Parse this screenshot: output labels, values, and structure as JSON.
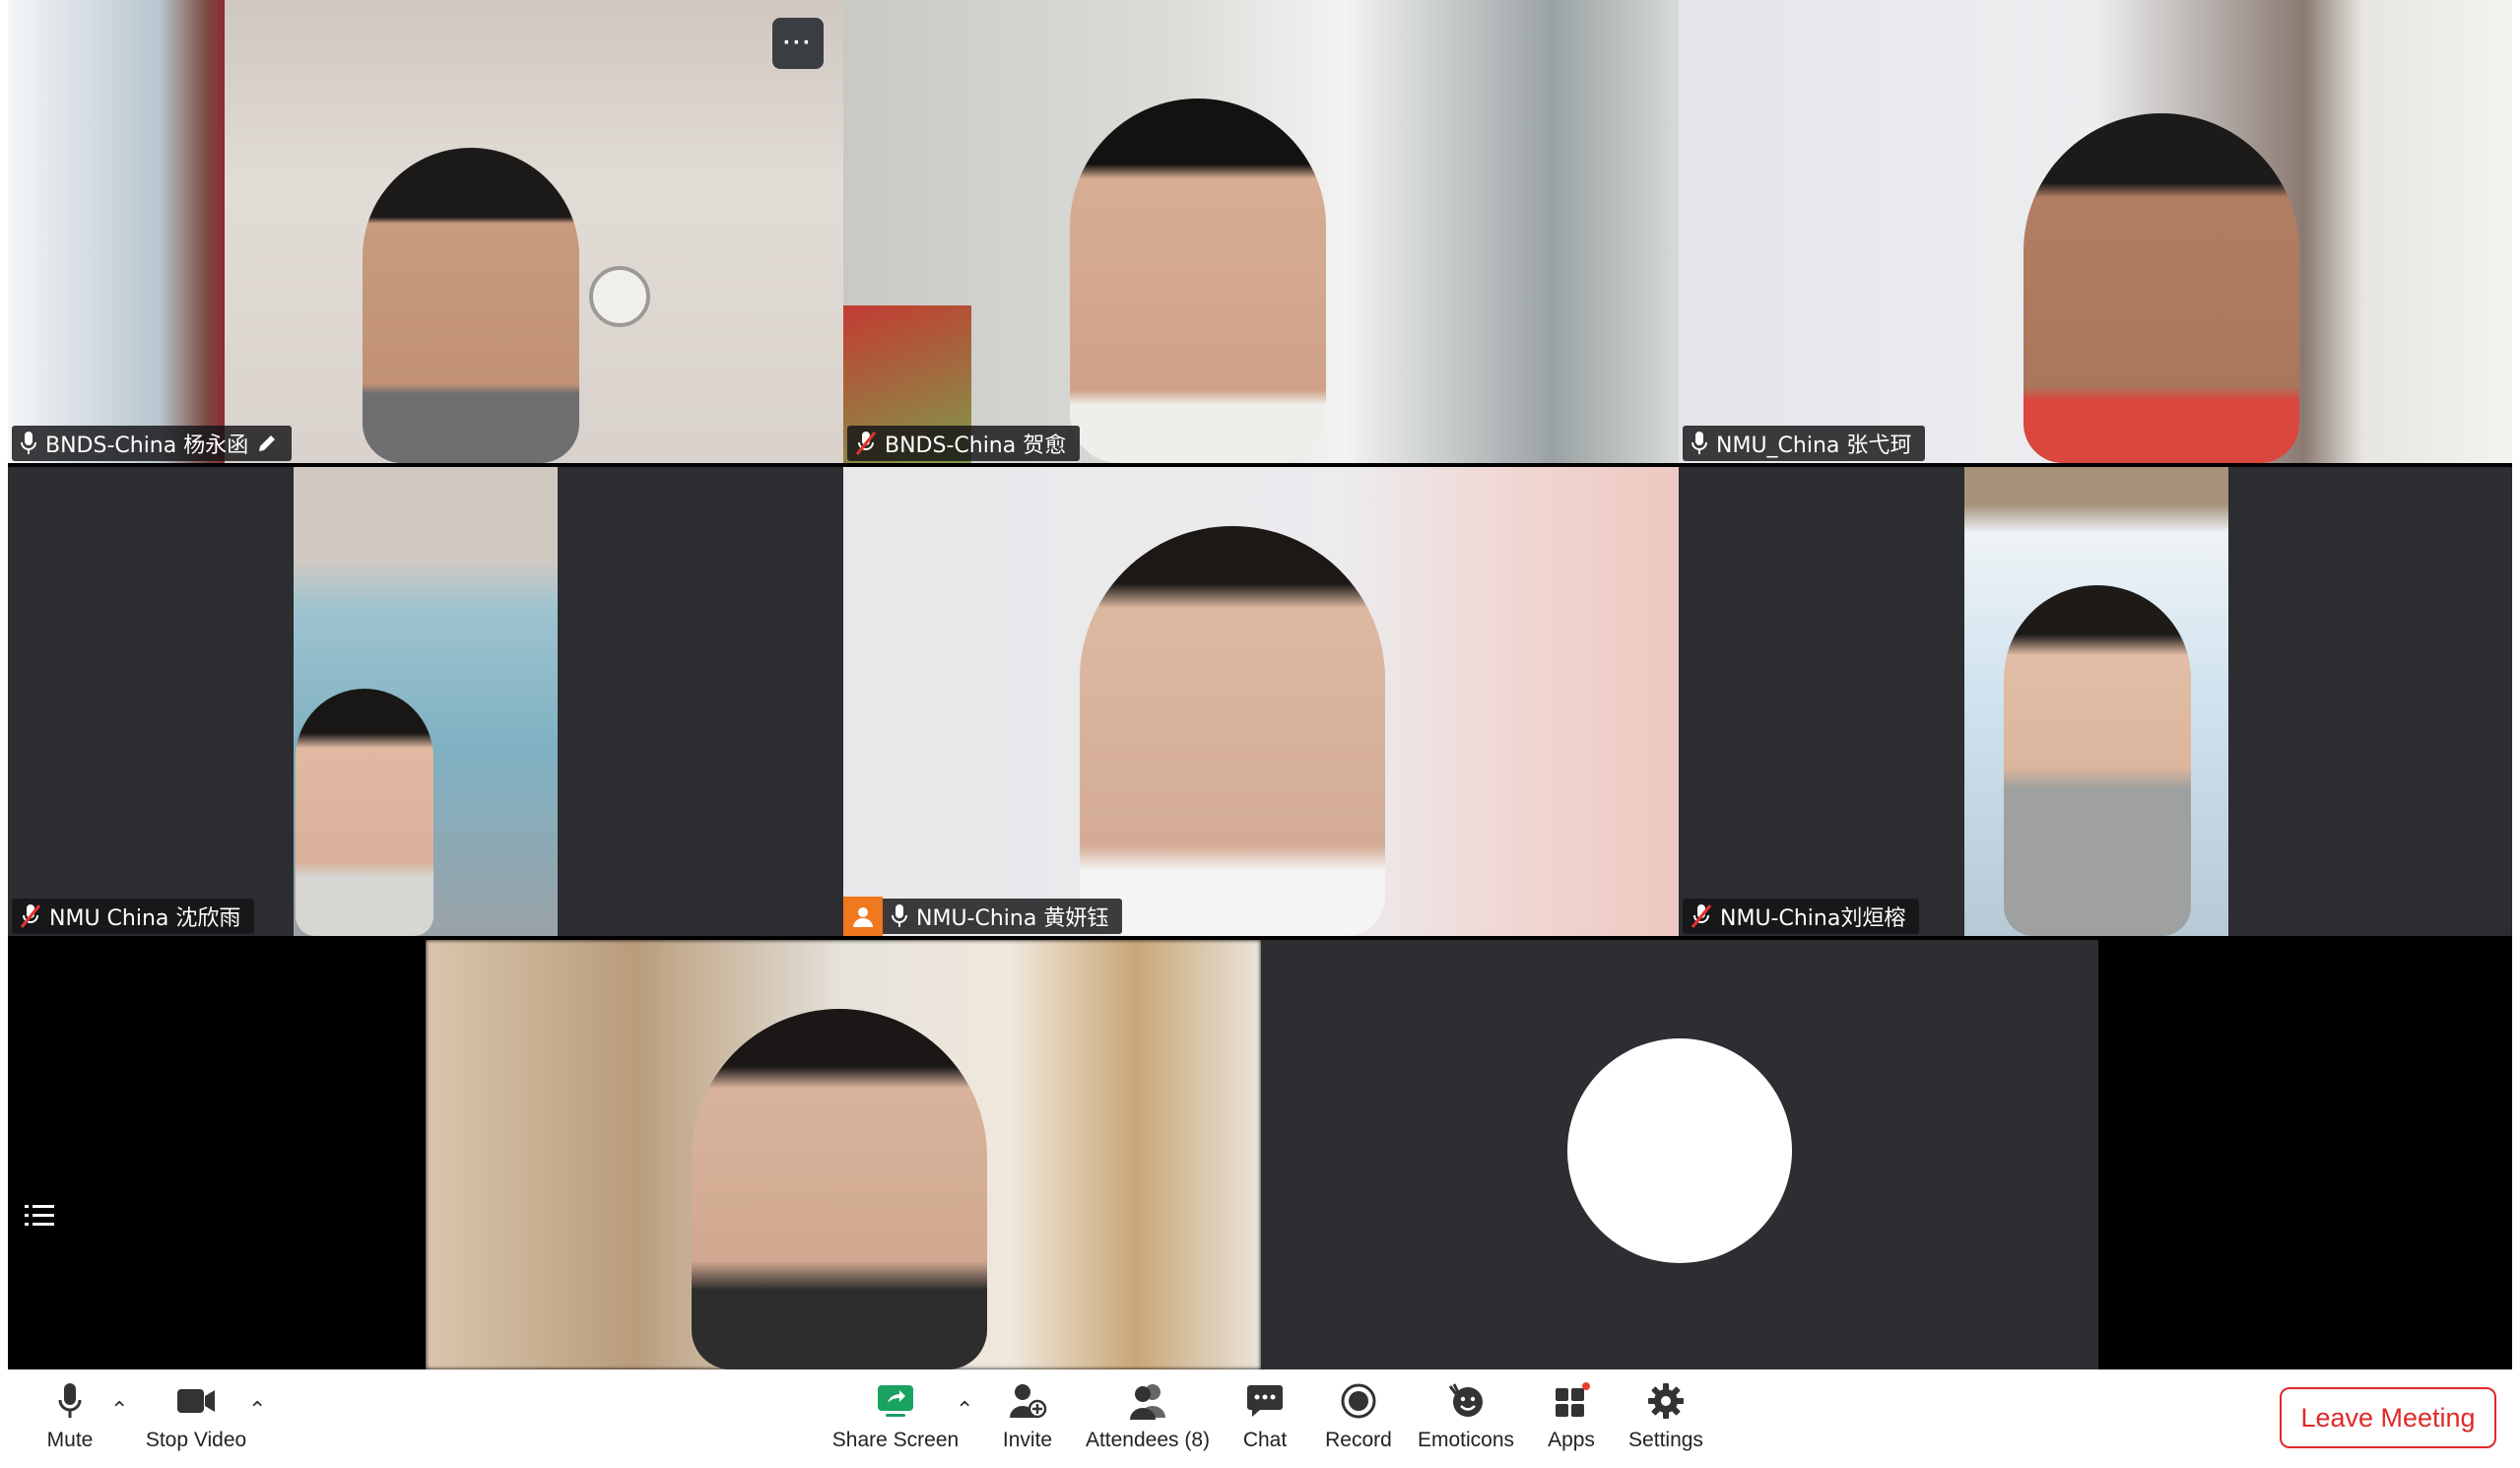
{
  "tiles": [
    {
      "name": "BNDS-China 杨永函",
      "mic": "on",
      "active": true
    },
    {
      "name": "BNDS-China 贺愈",
      "mic": "muted"
    },
    {
      "name": "NMU_China 张弋珂",
      "mic": "on"
    },
    {
      "name": "NMU China 沈欣雨",
      "mic": "muted"
    },
    {
      "name": "NMU-China 黄妍钰",
      "mic": "on"
    },
    {
      "name": "NMU-China刘烜榕",
      "mic": "muted"
    }
  ],
  "more_options": "···",
  "toolbar": {
    "mute": "Mute",
    "stop_video": "Stop Video",
    "share_screen": "Share Screen",
    "invite": "Invite",
    "attendees": "Attendees (8)",
    "chat": "Chat",
    "record": "Record",
    "emoticons": "Emoticons",
    "apps": "Apps",
    "settings": "Settings",
    "leave": "Leave Meeting"
  },
  "colors": {
    "active_speaker": "#23c552",
    "leave_red": "#e02828",
    "share_green": "#1aa260",
    "badge_orange": "#f0781e"
  }
}
